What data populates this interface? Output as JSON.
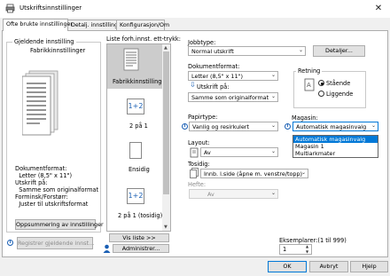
{
  "window": {
    "title": "Utskriftsinnstillinger",
    "close_glyph": "✕"
  },
  "tabs": [
    {
      "label": "Ofte brukte innstillinger"
    },
    {
      "label": "Detalj. innstillinger"
    },
    {
      "label": "Konfigurasjon/Om"
    }
  ],
  "current_settings": {
    "heading": "Gjeldende innstilling",
    "subheading": "Fabrikkinnstillinger",
    "summary": [
      "Dokumentformat:",
      "  Letter (8,5\" x 11\")",
      "Utskrift på:",
      "  Samme som originalformat",
      "Forminsk/Forstørr:",
      "  Juster til utskriftsformat"
    ],
    "summary_button": "Oppsummering av innstillinger",
    "register_button": "Registrer gjeldende innst..."
  },
  "presets": {
    "label": "Liste forh.innst. ett-trykk:",
    "items": [
      {
        "label": "Fabrikkinnstillinger",
        "icon": "document-icon",
        "selected": true
      },
      {
        "label": "2 på 1",
        "icon": "two-up-icon",
        "glyph": "1+2"
      },
      {
        "label": "Ensidig",
        "icon": "single-sided-icon"
      },
      {
        "label": "2 på 1 (tosidig)",
        "icon": "two-up-duplex-icon",
        "glyph": "1+2"
      }
    ],
    "show_list_button": "Vis liste >>",
    "admin_button": "Administrer..."
  },
  "job": {
    "type_label": "Jobbtype:",
    "type_value": "Normal utskrift",
    "details_button": "Detaljer..."
  },
  "document": {
    "format_label": "Dokumentformat:",
    "format_value": "Letter (8,5\" x 11\")",
    "print_on_label": "Utskrift på:",
    "print_on_value": "Samme som originalformat"
  },
  "orientation": {
    "label": "Retning",
    "options": [
      {
        "label": "Stående",
        "selected": true
      },
      {
        "label": "Liggende",
        "selected": false
      }
    ]
  },
  "paper": {
    "type_label": "Papirtype:",
    "type_value": "Vanlig og resirkulert",
    "tray_label": "Magasin:",
    "tray_value": "Automatisk magasinvalg",
    "tray_options": [
      "Automatisk magasinvalg",
      "Magasin 1",
      "Multiarkmater"
    ],
    "tray_selected_index": 0
  },
  "layout": {
    "label": "Layout:",
    "value": "Av"
  },
  "duplex": {
    "label": "Tosidig:",
    "value": "Innb. l.side (åpne m. venstre/topp)"
  },
  "staple": {
    "label": "Hefte:",
    "value": "Av"
  },
  "copies": {
    "label": "Eksemplarer:(1 til 999)",
    "value": "1"
  },
  "footer": {
    "ok": "OK",
    "cancel": "Avbryt",
    "help": "Hjelp"
  },
  "colors": {
    "accent": "#0078d7",
    "info": "#1a5fb4"
  }
}
